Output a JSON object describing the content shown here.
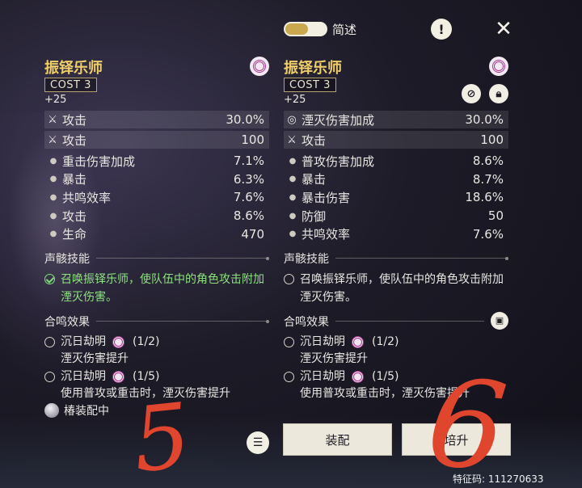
{
  "header": {
    "toggle_label": "简述",
    "info_glyph": "!"
  },
  "left_echo": {
    "name": "振铎乐师",
    "cost": "COST 3",
    "level": "+25",
    "main_stats": [
      {
        "icon": "crossed-swords-icon",
        "name": "攻击",
        "value": "30.0%"
      },
      {
        "icon": "crossed-swords-icon",
        "name": "攻击",
        "value": "100"
      }
    ],
    "sub_stats": [
      {
        "name": "重击伤害加成",
        "value": "7.1%"
      },
      {
        "name": "暴击",
        "value": "6.3%"
      },
      {
        "name": "共鸣效率",
        "value": "7.6%"
      },
      {
        "name": "攻击",
        "value": "8.6%"
      },
      {
        "name": "生命",
        "value": "470"
      }
    ],
    "skill_title": "声骸技能",
    "skill_text": "召唤振铎乐师，使队伍中的角色攻击附加湮灭伤害。",
    "resonance_title": "合鸣效果",
    "resonance": [
      {
        "name": "沉日劫明",
        "count": "(1/2)",
        "desc": "湮灭伤害提升"
      },
      {
        "name": "沉日劫明",
        "count": "(1/5)",
        "desc": "使用普攻或重击时，湮灭伤害提升"
      }
    ],
    "equipped_label": "椿装配中"
  },
  "right_echo": {
    "name": "振铎乐师",
    "cost": "COST 3",
    "level": "+25",
    "main_stats": [
      {
        "icon": "havoc-icon",
        "name": "湮灭伤害加成",
        "value": "30.0%"
      },
      {
        "icon": "crossed-swords-icon",
        "name": "攻击",
        "value": "100"
      }
    ],
    "sub_stats": [
      {
        "name": "普攻伤害加成",
        "value": "8.6%"
      },
      {
        "name": "暴击",
        "value": "8.7%"
      },
      {
        "name": "暴击伤害",
        "value": "18.6%"
      },
      {
        "name": "防御",
        "value": "50"
      },
      {
        "name": "共鸣效率",
        "value": "7.6%"
      }
    ],
    "skill_title": "声骸技能",
    "skill_text": "召唤振铎乐师，使队伍中的角色攻击附加湮灭伤害。",
    "resonance_title": "合鸣效果",
    "resonance": [
      {
        "name": "沉日劫明",
        "count": "(1/2)",
        "desc": "湮灭伤害提升"
      },
      {
        "name": "沉日劫明",
        "count": "(1/5)",
        "desc": "使用普攻或重击时，湮灭伤害提升"
      }
    ]
  },
  "actions": {
    "equip_label": "装配",
    "upgrade_label": "培升"
  },
  "uid_text": "特征码: 111270633",
  "annotations": {
    "left_mark": "5",
    "right_mark": "6"
  },
  "colors": {
    "echo_name": "#f0cf6a",
    "active_skill": "#8ee27f",
    "havoc": "#a63b8e",
    "annotation": "#e0462e"
  }
}
